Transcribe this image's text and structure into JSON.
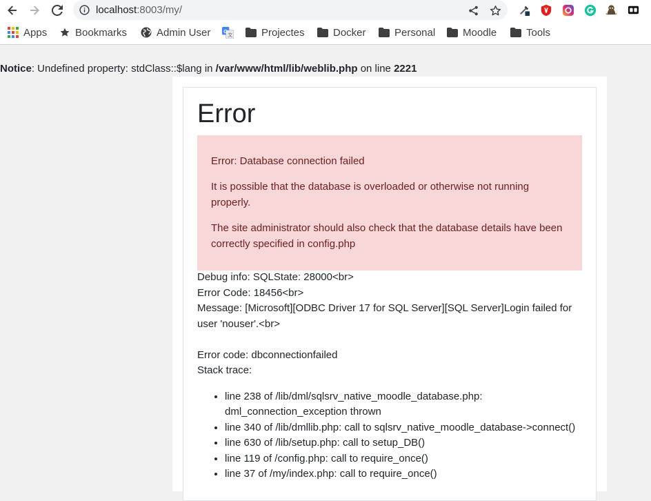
{
  "browser": {
    "url_host": "localhost",
    "url_rest": ":8003/my/"
  },
  "bookmarks": [
    {
      "label": "Apps",
      "icon": "apps-grid-icon"
    },
    {
      "label": "Bookmarks",
      "icon": "star-icon"
    },
    {
      "label": "Admin User",
      "icon": "globe-icon"
    },
    {
      "label": "",
      "icon": "google-translate-icon"
    },
    {
      "label": "Projectes",
      "icon": "folder-icon"
    },
    {
      "label": "Docker",
      "icon": "folder-icon"
    },
    {
      "label": "Personal",
      "icon": "folder-icon"
    },
    {
      "label": "Moodle",
      "icon": "folder-icon"
    },
    {
      "label": "Tools",
      "icon": "folder-icon"
    }
  ],
  "notice": {
    "label": "Notice",
    "text": ": Undefined property: stdClass::$lang in ",
    "file": "/var/www/html/lib/weblib.php",
    "on_line": " on line ",
    "line": "2221"
  },
  "error": {
    "title": "Error",
    "alert_lines": [
      "Error: Database connection failed",
      "It is possible that the database is overloaded or otherwise not running properly.",
      "The site administrator should also check that the database details have been correctly specified in config.php"
    ],
    "debug_lines": [
      "Debug info: SQLState: 28000<br>",
      "Error Code: 18456<br>",
      "Message: [Microsoft][ODBC Driver 17 for SQL Server][SQL Server]Login failed for user 'nouser'.<br>",
      "",
      "Error code: dbconnectionfailed",
      "Stack trace:"
    ],
    "stack_trace": [
      "line 238 of /lib/dml/sqlsrv_native_moodle_database.php: dml_connection_exception thrown",
      "line 340 of /lib/dmllib.php: call to sqlsrv_native_moodle_database->connect()",
      "line 630 of /lib/setup.php: call to setup_DB()",
      "line 119 of /config.php: call to require_once()",
      "line 37 of /my/index.php: call to require_once()"
    ]
  },
  "colors": {
    "alert_bg": "#f7d7d7",
    "alert_text": "#6e2020"
  }
}
